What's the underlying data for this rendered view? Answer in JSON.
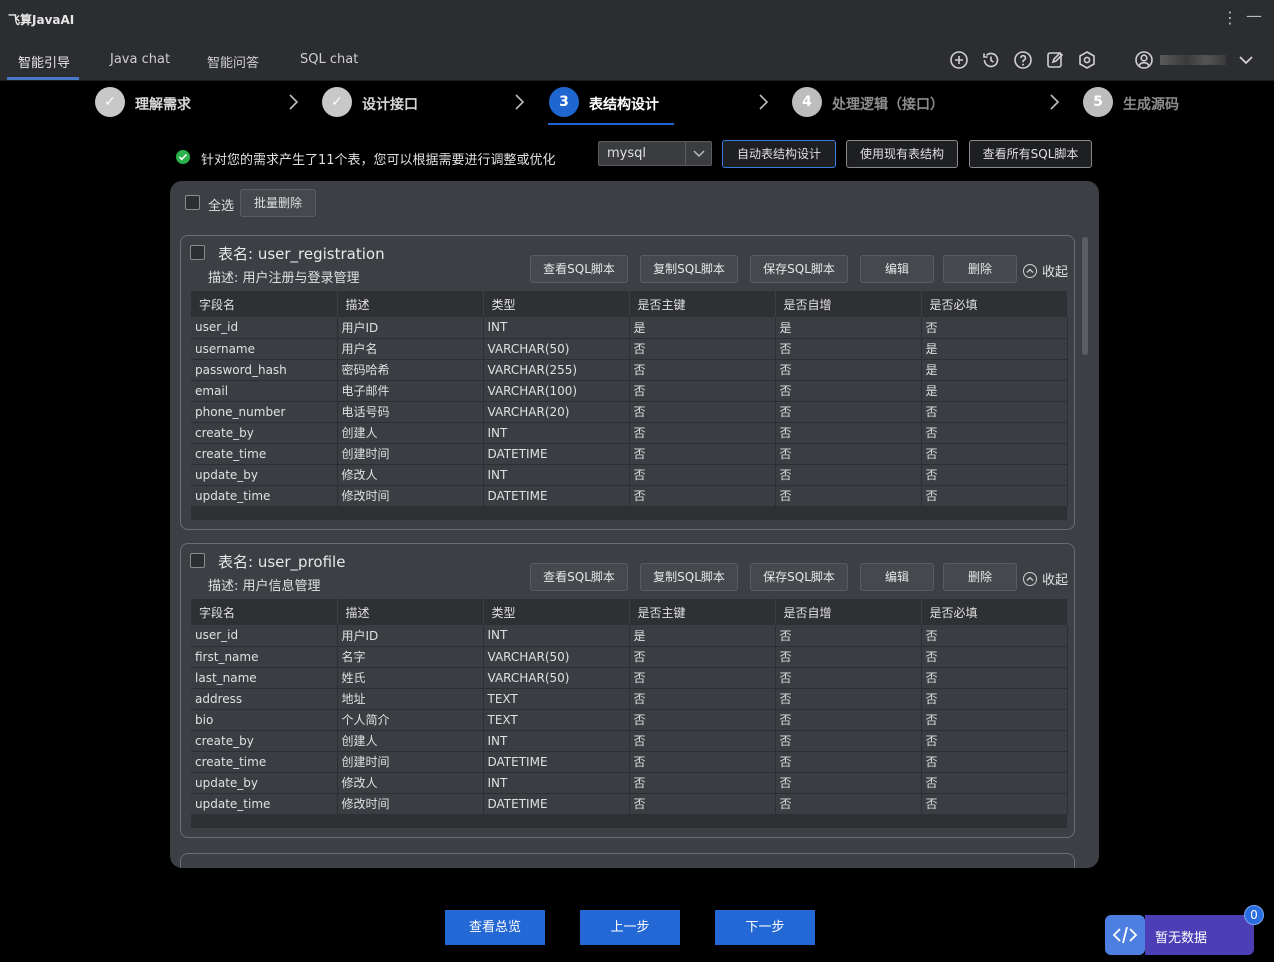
{
  "app": {
    "title": "飞算JavaAI"
  },
  "nav": {
    "tabs": [
      {
        "label": "智能引导",
        "active": true
      },
      {
        "label": "Java chat"
      },
      {
        "label": "智能问答"
      },
      {
        "label": "SQL chat"
      }
    ],
    "icons": [
      "plus-circle-icon",
      "history-icon",
      "help-icon",
      "edit-icon",
      "settings-icon",
      "user-icon"
    ]
  },
  "steps": [
    {
      "num": "✓",
      "label": "理解需求",
      "state": "done"
    },
    {
      "num": "✓",
      "label": "设计接口",
      "state": "done"
    },
    {
      "num": "3",
      "label": "表结构设计",
      "state": "current"
    },
    {
      "num": "4",
      "label": "处理逻辑（接口）",
      "state": "todo"
    },
    {
      "num": "5",
      "label": "生成源码",
      "state": "todo"
    }
  ],
  "info": {
    "message": "针对您的需求产生了11个表，您可以根据需要进行调整或优化"
  },
  "db_select": {
    "value": "mysql"
  },
  "top_buttons": {
    "auto_design": "自动表结构设计",
    "use_existing": "使用现有表结构",
    "view_all_sql": "查看所有SQL脚本"
  },
  "panel": {
    "select_all": "全选",
    "bulk_delete": "批量删除"
  },
  "card_actions": {
    "view_sql": "查看SQL脚本",
    "copy_sql": "复制SQL脚本",
    "save_sql": "保存SQL脚本",
    "edit": "编辑",
    "delete": "删除",
    "collapse": "收起"
  },
  "columns": [
    "字段名",
    "描述",
    "类型",
    "是否主键",
    "是否自增",
    "是否必填"
  ],
  "tables": [
    {
      "name": "表名: user_registration",
      "desc": "描述: 用户注册与登录管理",
      "rows": [
        [
          "user_id",
          "用户ID",
          "INT",
          "是",
          "是",
          "否"
        ],
        [
          "username",
          "用户名",
          "VARCHAR(50)",
          "否",
          "否",
          "是"
        ],
        [
          "password_hash",
          "密码哈希",
          "VARCHAR(255)",
          "否",
          "否",
          "是"
        ],
        [
          "email",
          "电子邮件",
          "VARCHAR(100)",
          "否",
          "否",
          "是"
        ],
        [
          "phone_number",
          "电话号码",
          "VARCHAR(20)",
          "否",
          "否",
          "否"
        ],
        [
          "create_by",
          "创建人",
          "INT",
          "否",
          "否",
          "否"
        ],
        [
          "create_time",
          "创建时间",
          "DATETIME",
          "否",
          "否",
          "否"
        ],
        [
          "update_by",
          "修改人",
          "INT",
          "否",
          "否",
          "否"
        ],
        [
          "update_time",
          "修改时间",
          "DATETIME",
          "否",
          "否",
          "否"
        ]
      ]
    },
    {
      "name": "表名: user_profile",
      "desc": "描述: 用户信息管理",
      "rows": [
        [
          "user_id",
          "用户ID",
          "INT",
          "是",
          "否",
          "否"
        ],
        [
          "first_name",
          "名字",
          "VARCHAR(50)",
          "否",
          "否",
          "否"
        ],
        [
          "last_name",
          "姓氏",
          "VARCHAR(50)",
          "否",
          "否",
          "否"
        ],
        [
          "address",
          "地址",
          "TEXT",
          "否",
          "否",
          "否"
        ],
        [
          "bio",
          "个人简介",
          "TEXT",
          "否",
          "否",
          "否"
        ],
        [
          "create_by",
          "创建人",
          "INT",
          "否",
          "否",
          "否"
        ],
        [
          "create_time",
          "创建时间",
          "DATETIME",
          "否",
          "否",
          "否"
        ],
        [
          "update_by",
          "修改人",
          "INT",
          "否",
          "否",
          "否"
        ],
        [
          "update_time",
          "修改时间",
          "DATETIME",
          "否",
          "否",
          "否"
        ]
      ]
    }
  ],
  "bottom_buttons": {
    "overview": "查看总览",
    "prev": "上一步",
    "next": "下一步"
  },
  "widget": {
    "text": "暂无数据",
    "badge": "0"
  },
  "colors": {
    "accent": "#1f66d1",
    "success": "#2bb24c",
    "widget": "#4c3fb5"
  }
}
